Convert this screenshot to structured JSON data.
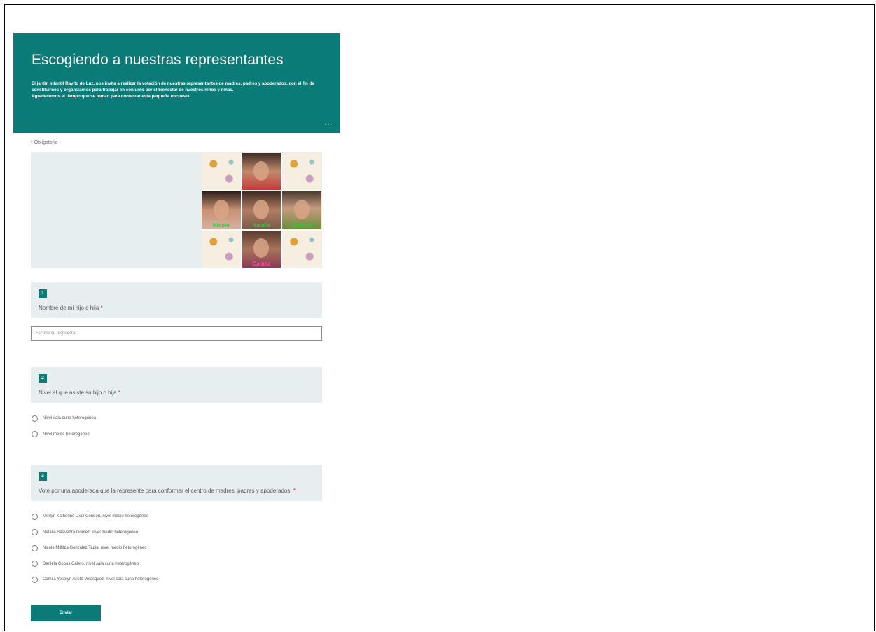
{
  "form": {
    "title": "Escogiendo a nuestras representantes",
    "description_line1": "El jardín infantil Rayito de Luz, nos invita a realizar la votación de nuestras representantes de madres, padres y apoderados, con el fin de constituirnos y organizarnos para trabajar en conjunto por el bienestar de nuestros niños y niñas.",
    "description_line2": "Agradecemos el tiempo que se toman para contestar esta pequeña encuesta.",
    "more_label": "...",
    "required_star": "*",
    "required_note": "Obligatorio"
  },
  "banner": {
    "names": [
      "Nicole",
      "Natalie",
      "Daniela",
      "Camila"
    ]
  },
  "questions": [
    {
      "number": "1",
      "text": "Nombre de mi hijo o hija",
      "required": "*",
      "placeholder": "Escriba su respuesta"
    },
    {
      "number": "2",
      "text": "Nivel al que asiste su hijo o hija",
      "required": "*",
      "options": [
        "Nivel sala cuna heterogénea",
        "Nivel medio heterogéneo"
      ]
    },
    {
      "number": "3",
      "text": "Vote por una apoderada que la represente para conformar el centro de madres, padres y apoderados.",
      "required": "*",
      "options": [
        "Merlyn Katherine Díaz Condori, nivel medio heterogéneo",
        "Natalie Saavedra Gómez, nivel medio heterogéneo",
        "Nicole Millitza González Tapia, nivel medio heterogénec",
        "Daniela Cobos Calero, nivel sala cuna heterogéneo",
        "Camila Yoselyn Ariste Velásquez, nivel sala cuna heterogéneo"
      ]
    }
  ],
  "submit_label": "Enviar",
  "colors": {
    "accent": "#0b7b78",
    "question_bg": "#e6eef0",
    "required": "#c4314b"
  }
}
